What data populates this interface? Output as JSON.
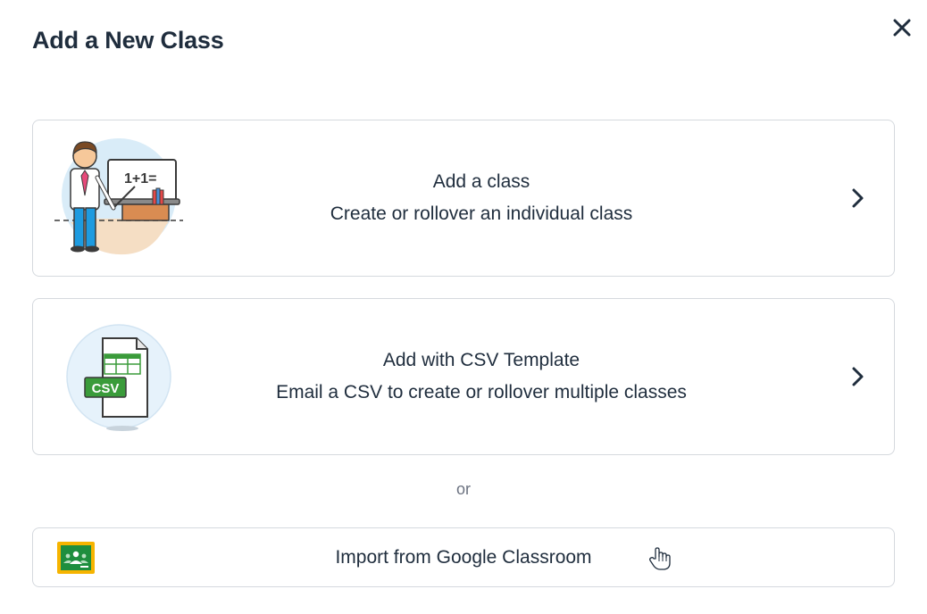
{
  "dialog": {
    "title": "Add a New Class",
    "close_icon": "close-icon"
  },
  "options": [
    {
      "title": "Add a class",
      "subtitle": "Create or rollover an individual class",
      "icon": "teacher-illustration",
      "arrow": "chevron-right-icon"
    },
    {
      "title": "Add with CSV Template",
      "subtitle": "Email a CSV to create or rollover multiple classes",
      "icon": "csv-file-illustration",
      "badge": "CSV",
      "arrow": "chevron-right-icon"
    }
  ],
  "divider_text": "or",
  "google": {
    "label": "Import from Google Classroom",
    "icon": "google-classroom-icon"
  },
  "illustration_text": "1+1=",
  "colors": {
    "text": "#1f2d3d",
    "border": "#d5d9de",
    "muted": "#6b7280",
    "google_green": "#1e8e3e",
    "google_yellow": "#f6b400",
    "csv_green": "#3a9b3a"
  }
}
